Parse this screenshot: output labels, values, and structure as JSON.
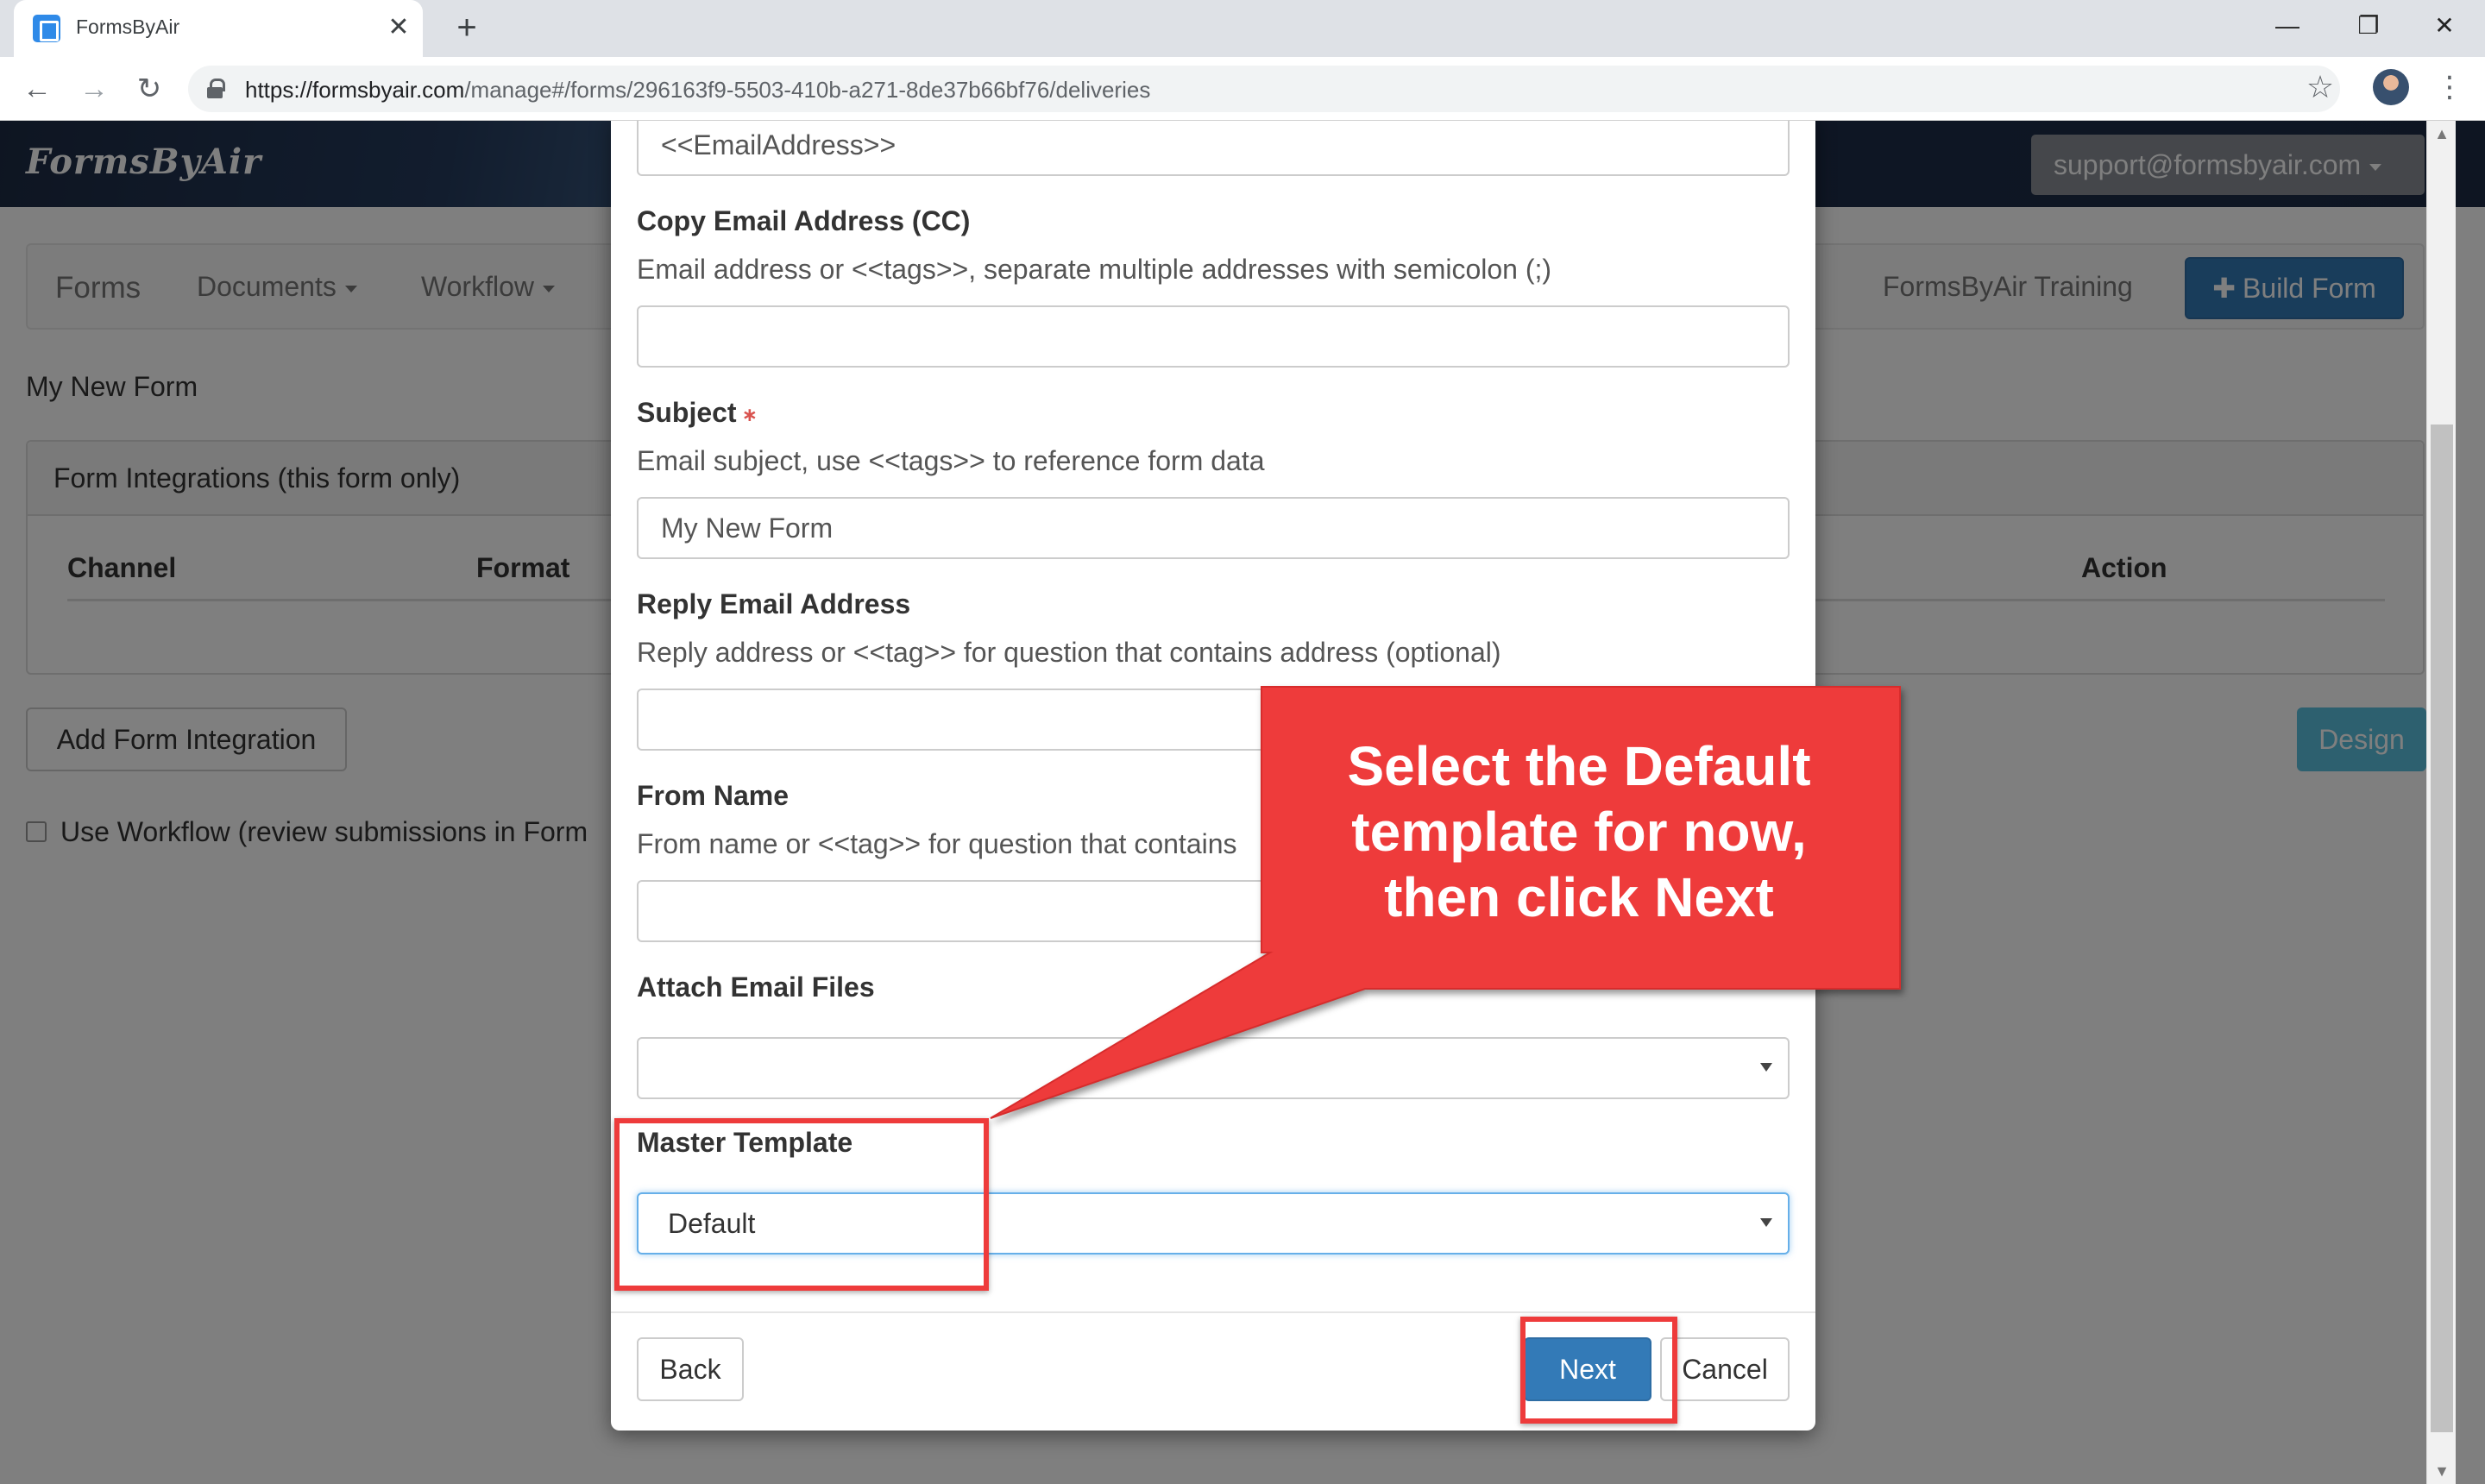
{
  "browser": {
    "tab_title": "FormsByAir",
    "tab_close": "✕",
    "new_tab": "+",
    "url_host": "https://formsbyair.com",
    "url_path": "/manage#/forms/296163f9-5503-410b-a271-8de37b66bf76/deliveries",
    "back": "←",
    "forward": "→",
    "reload": "↻",
    "star": "☆",
    "menu": "⋮",
    "minimize": "—",
    "restore": "❐",
    "close": "✕"
  },
  "app": {
    "brand": "FormsByAir",
    "account": "support@formsbyair.com",
    "nav": {
      "forms": "Forms",
      "documents": "Documents",
      "workflow": "Workflow",
      "training": "FormsByAir Training",
      "build_form": "Build Form",
      "build_plus": "✚"
    },
    "form_title": "My New Form",
    "panel_title": "Form Integrations (this form only)",
    "columns": {
      "channel": "Channel",
      "format": "Format",
      "action": "Action"
    },
    "add_integration": "Add Form Integration",
    "design": "Design",
    "use_workflow": "Use Workflow (review submissions in Form"
  },
  "modal": {
    "to_value": "<<EmailAddress>>",
    "cc_label": "Copy Email Address (CC)",
    "cc_help": "Email address or <<tags>>, separate multiple addresses with semicolon (;)",
    "cc_value": "",
    "subject_label": "Subject",
    "required_mark": "∗",
    "subject_help": "Email subject, use <<tags>> to reference form data",
    "subject_value": "My New Form",
    "reply_label": "Reply Email Address",
    "reply_help": "Reply address or <<tag>> for question that contains address (optional)",
    "reply_value": "",
    "from_label": "From Name",
    "from_help": "From name or <<tag>> for question that contains",
    "from_value": "",
    "attach_label": "Attach Email Files",
    "attach_value": "",
    "master_label": "Master Template",
    "master_value": "Default",
    "back": "Back",
    "next": "Next",
    "cancel": "Cancel"
  },
  "annotation": {
    "callout_line1": "Select the Default",
    "callout_line2": "template for now,",
    "callout_line3": "then click Next",
    "callout_color": "#ee3b3b"
  }
}
